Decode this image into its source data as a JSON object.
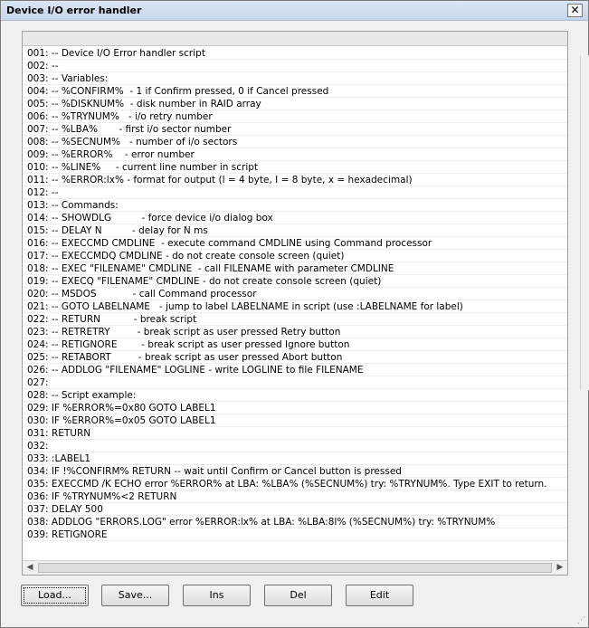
{
  "window": {
    "title": "Device I/O error handler",
    "close_icon": "close-icon"
  },
  "script_lines": [
    "001: -- Device I/O Error handler script",
    "002: --",
    "003: -- Variables:",
    "004: -- %CONFIRM%  - 1 if Confirm pressed, 0 if Cancel pressed",
    "005: -- %DISKNUM%  - disk number in RAID array",
    "006: -- %TRYNUM%   - i/o retry number",
    "007: -- %LBA%       - first i/o sector number",
    "008: -- %SECNUM%   - number of i/o sectors",
    "009: -- %ERROR%    - error number",
    "010: -- %LINE%     - current line number in script",
    "011: -- %ERROR:lx% - format for output (l = 4 byte, I = 8 byte, x = hexadecimal)",
    "012: --",
    "013: -- Commands:",
    "014: -- SHOWDLG          - force device i/o dialog box",
    "015: -- DELAY N          - delay for N ms",
    "016: -- EXECCMD CMDLINE  - execute command CMDLINE using Command processor",
    "017: -- EXECCMDQ CMDLINE - do not create console screen (quiet)",
    "018: -- EXEC \"FILENAME\" CMDLINE  - call FILENAME with parameter CMDLINE",
    "019: -- EXECQ \"FILENAME\" CMDLINE - do not create console screen (quiet)",
    "020: -- MSDOS            - call Command processor",
    "021: -- GOTO LABELNAME   - jump to label LABELNAME in script (use :LABELNAME for label)",
    "022: -- RETURN           - break script",
    "023: -- RETRETRY         - break script as user pressed Retry button",
    "024: -- RETIGNORE        - break script as user pressed Ignore button",
    "025: -- RETABORT         - break script as user pressed Abort button",
    "026: -- ADDLOG \"FILENAME\" LOGLINE - write LOGLINE to file FILENAME",
    "027:",
    "028: -- Script example:",
    "029: IF %ERROR%=0x80 GOTO LABEL1",
    "030: IF %ERROR%=0x05 GOTO LABEL1",
    "031: RETURN",
    "032:",
    "033: :LABEL1",
    "034: IF !%CONFIRM% RETURN -- wait until Confirm or Cancel button is pressed",
    "035: EXECCMD /K ECHO error %ERROR% at LBA: %LBA% (%SECNUM%) try: %TRYNUM%. Type EXIT to return.",
    "036: IF %TRYNUM%<2 RETURN",
    "037: DELAY 500",
    "038: ADDLOG \"ERRORS.LOG\" error %ERROR:lx% at LBA: %LBA:8I% (%SECNUM%) try: %TRYNUM%",
    "039: RETIGNORE"
  ],
  "buttons": {
    "load": "Load...",
    "save": "Save...",
    "ins": "Ins",
    "del": "Del",
    "edit": "Edit"
  },
  "scroll": {
    "left_arrow": "◀",
    "right_arrow": "▶"
  }
}
